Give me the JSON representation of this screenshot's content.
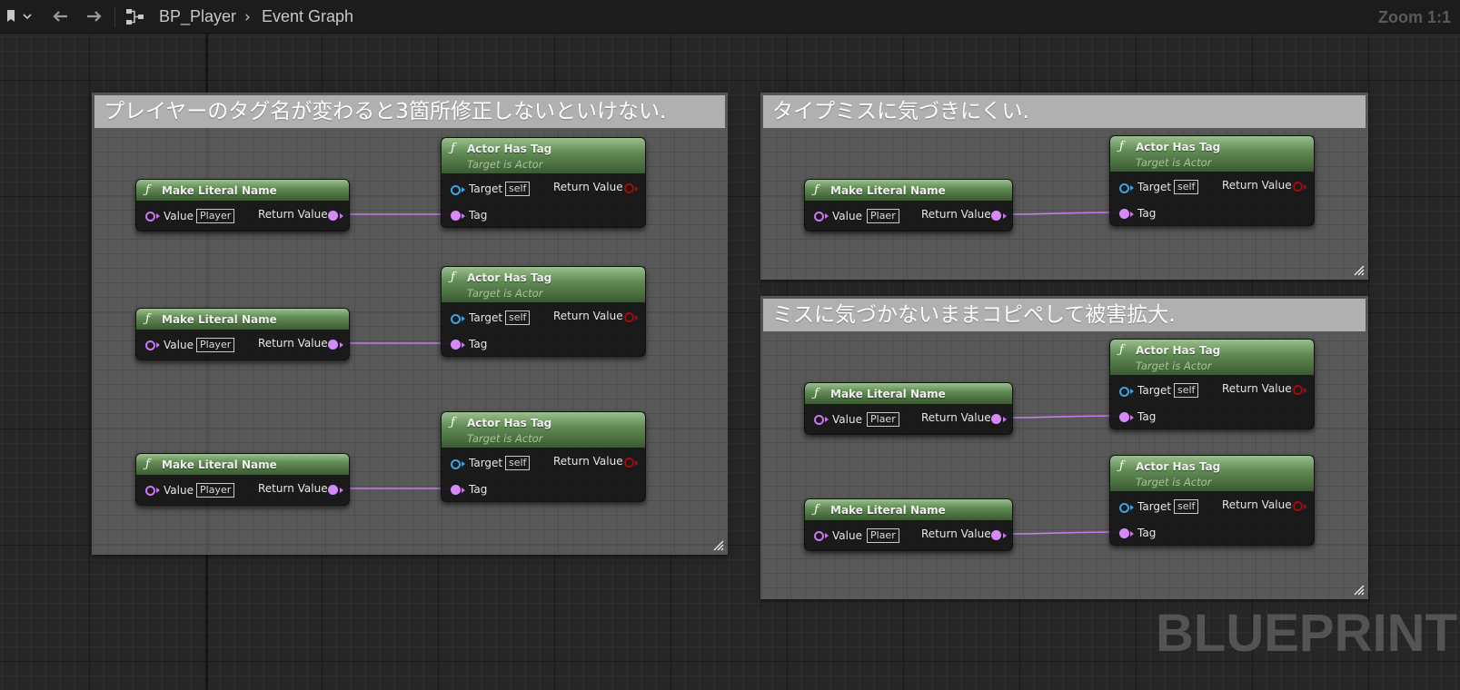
{
  "toolbar": {
    "breadcrumb": [
      "BP_Player",
      "Event Graph"
    ],
    "zoom": "Zoom 1:1",
    "icons": [
      "bookmark-icon",
      "chevron-down-icon",
      "back-arrow-icon",
      "forward-arrow-icon",
      "graph-icon",
      "chevron-right-icon"
    ]
  },
  "comments": [
    {
      "title": "プレイヤーのタグ名が変わると3箇所修正しないといけない."
    },
    {
      "title": "タイプミスに気づきにくい."
    },
    {
      "title": "ミスに気づかないままコピペして被害拡大."
    }
  ],
  "literal_nodes": [
    {
      "title": "Make Literal Name",
      "value_label": "Value",
      "value": "Player",
      "output_label": "Return Value"
    },
    {
      "title": "Make Literal Name",
      "value_label": "Value",
      "value": "Player",
      "output_label": "Return Value"
    },
    {
      "title": "Make Literal Name",
      "value_label": "Value",
      "value": "Player",
      "output_label": "Return Value"
    },
    {
      "title": "Make Literal Name",
      "value_label": "Value",
      "value": "Plaer",
      "output_label": "Return Value"
    },
    {
      "title": "Make Literal Name",
      "value_label": "Value",
      "value": "Plaer",
      "output_label": "Return Value"
    },
    {
      "title": "Make Literal Name",
      "value_label": "Value",
      "value": "Plaer",
      "output_label": "Return Value"
    }
  ],
  "tag_nodes": [
    {
      "title": "Actor Has Tag",
      "subtitle": "Target is Actor",
      "target_label": "Target",
      "target_value": "self",
      "output_label": "Return Value",
      "tag_label": "Tag"
    },
    {
      "title": "Actor Has Tag",
      "subtitle": "Target is Actor",
      "target_label": "Target",
      "target_value": "self",
      "output_label": "Return Value",
      "tag_label": "Tag"
    },
    {
      "title": "Actor Has Tag",
      "subtitle": "Target is Actor",
      "target_label": "Target",
      "target_value": "self",
      "output_label": "Return Value",
      "tag_label": "Tag"
    },
    {
      "title": "Actor Has Tag",
      "subtitle": "Target is Actor",
      "target_label": "Target",
      "target_value": "self",
      "output_label": "Return Value",
      "tag_label": "Tag"
    },
    {
      "title": "Actor Has Tag",
      "subtitle": "Target is Actor",
      "target_label": "Target",
      "target_value": "self",
      "output_label": "Return Value",
      "tag_label": "Tag"
    },
    {
      "title": "Actor Has Tag",
      "subtitle": "Target is Actor",
      "target_label": "Target",
      "target_value": "self",
      "output_label": "Return Value",
      "tag_label": "Tag"
    }
  ],
  "watermark": "BLUEPRINT",
  "colors": {
    "name_pin": "#d58af8",
    "object_pin": "#3aa6e8",
    "bool_pin": "#9a0e0e",
    "function_header": "#628d55"
  }
}
